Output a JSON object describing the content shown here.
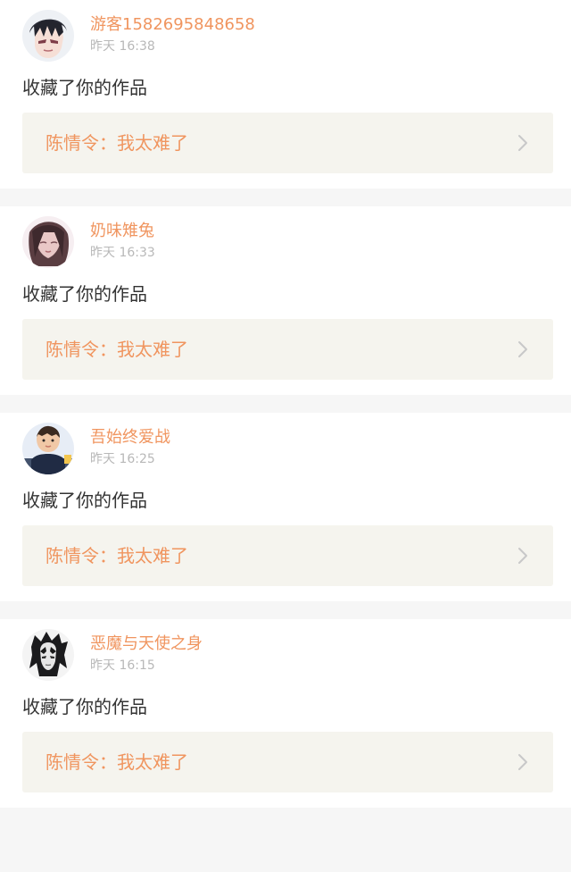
{
  "feed": {
    "items": [
      {
        "username": "游客1582695848658",
        "time": "昨天 16:38",
        "action": "收藏了你的作品",
        "work_title": "陈情令：我太难了",
        "avatar_icon": "avatar-anime-boy",
        "chevron_icon": "chevron-right-icon"
      },
      {
        "username": "奶味雉兔",
        "time": "昨天 16:33",
        "action": "收藏了你的作品",
        "work_title": "陈情令：我太难了",
        "avatar_icon": "avatar-long-hair",
        "chevron_icon": "chevron-right-icon"
      },
      {
        "username": "吾始终爱战",
        "time": "昨天 16:25",
        "action": "收藏了你的作品",
        "work_title": "陈情令：我太难了",
        "avatar_icon": "avatar-child",
        "chevron_icon": "chevron-right-icon"
      },
      {
        "username": "恶魔与天使之身",
        "time": "昨天 16:15",
        "action": "收藏了你的作品",
        "work_title": "陈情令：我太难了",
        "avatar_icon": "avatar-dark-anime",
        "chevron_icon": "chevron-right-icon"
      }
    ]
  },
  "colors": {
    "accent": "#f0955f",
    "background": "#f6f6f6",
    "card": "#ffffff",
    "work_box": "#f5f4ee",
    "meta": "#b8b8b8",
    "text": "#333333"
  }
}
